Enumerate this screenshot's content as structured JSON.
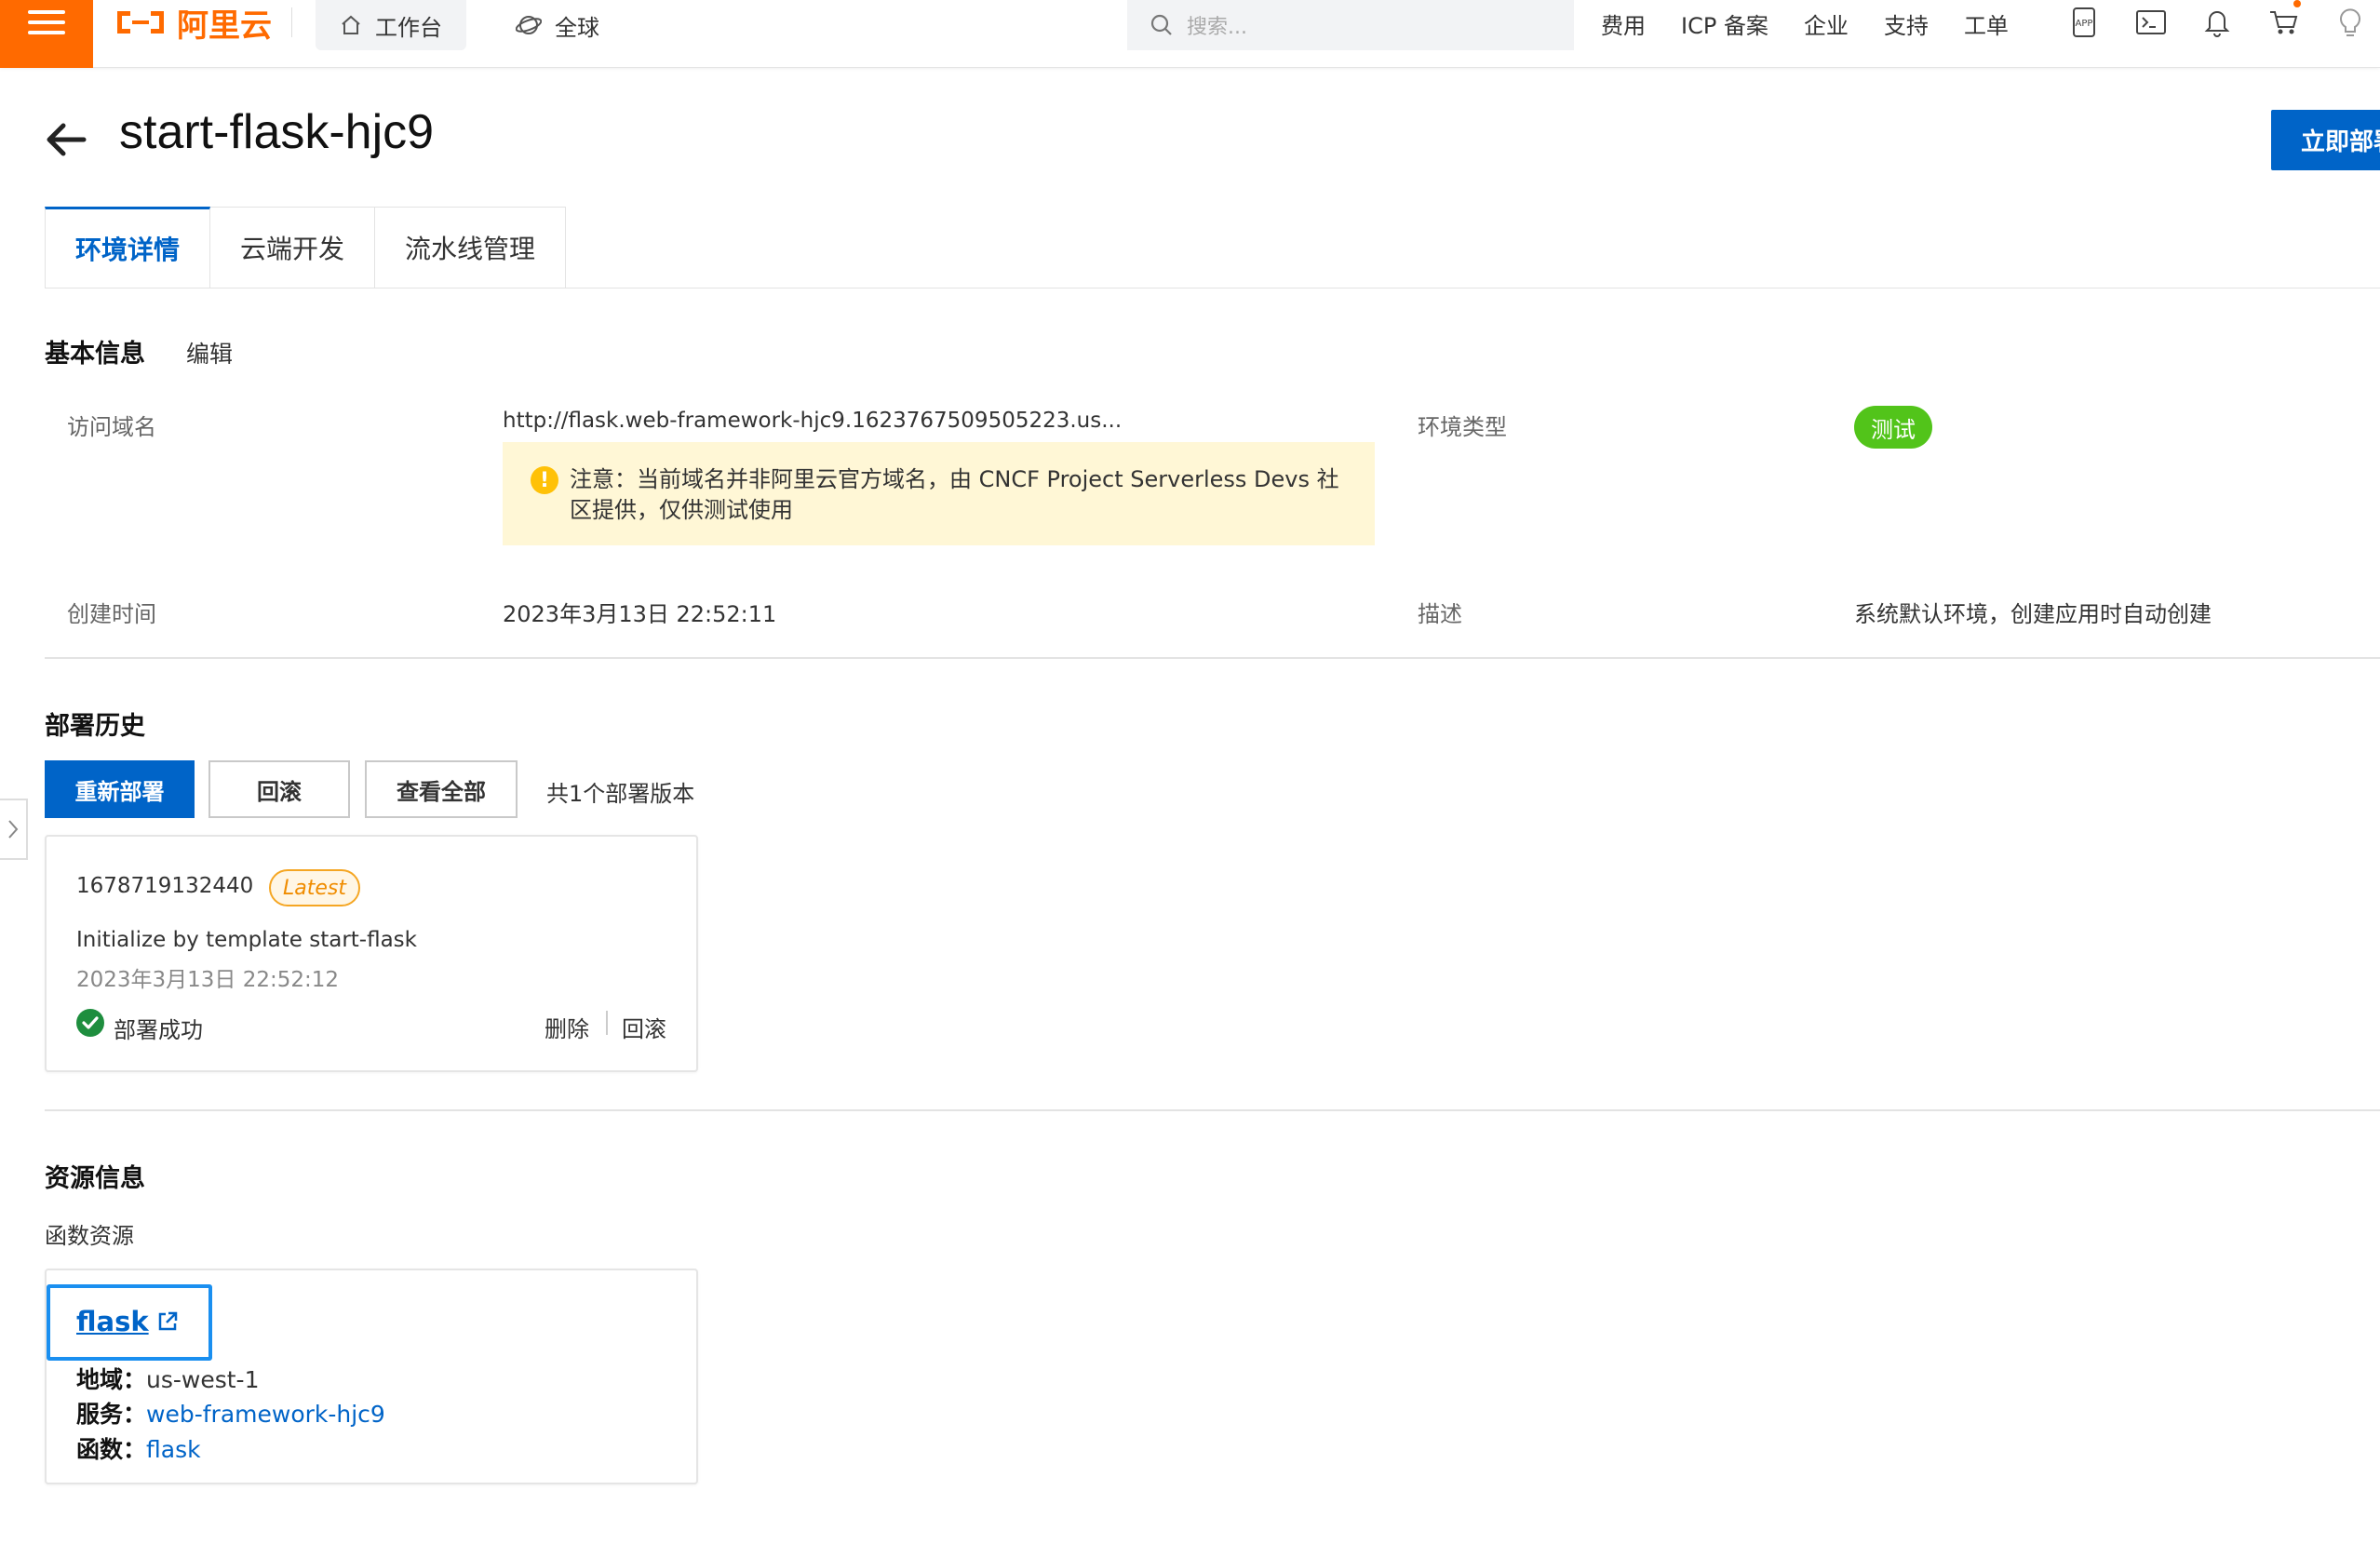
{
  "topbar": {
    "brand": "阿里云",
    "workbench": "工作台",
    "region": "全球",
    "search_placeholder": "搜索...",
    "links": [
      "费用",
      "ICP 备案",
      "企业",
      "支持",
      "工单"
    ],
    "icons": [
      "app-icon",
      "terminal-icon",
      "bell-icon",
      "cart-icon",
      "bulb-icon"
    ]
  },
  "header": {
    "title": "start-flask-hjc9",
    "deploy_button": "立即部署"
  },
  "tabs": [
    "环境详情",
    "云端开发",
    "流水线管理"
  ],
  "basic_info": {
    "title": "基本信息",
    "edit": "编辑",
    "domain_label": "访问域名",
    "domain_value": "http://flask.web-framework-hjc9.1623767509505223.us...",
    "notice": "注意：当前域名并非阿里云官方域名，由 CNCF Project Serverless Devs 社区提供，仅供测试使用",
    "env_type_label": "环境类型",
    "env_type_value": "测试",
    "created_label": "创建时间",
    "created_value": "2023年3月13日 22:52:11",
    "desc_label": "描述",
    "desc_value": "系统默认环境，创建应用时自动创建"
  },
  "deploy_history": {
    "title": "部署历史",
    "redeploy": "重新部署",
    "rollback": "回滚",
    "view_all": "查看全部",
    "count_text": "共1个部署版本",
    "record": {
      "id": "1678719132440",
      "badge": "Latest",
      "message": "Initialize by template start-flask",
      "time": "2023年3月13日 22:52:12",
      "status": "部署成功",
      "delete": "删除",
      "rollback": "回滚"
    }
  },
  "resources": {
    "title": "资源信息",
    "subtitle": "函数资源",
    "function_name": "flask",
    "region_label": "地域：",
    "region_value": "us-west-1",
    "service_label": "服务：",
    "service_value": "web-framework-hjc9",
    "function_label": "函数：",
    "function_value": "flask"
  },
  "colors": {
    "brand_orange": "#ff6a00",
    "primary_blue": "#0064c8",
    "success_green": "#52c41a",
    "notice_bg": "#fff7d6"
  }
}
